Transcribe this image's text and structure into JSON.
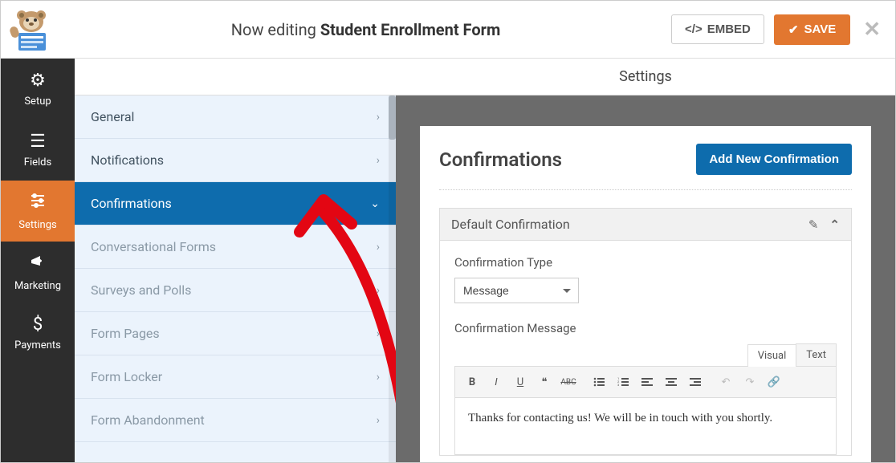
{
  "header": {
    "editing_prefix": "Now editing ",
    "form_name": "Student Enrollment Form",
    "embed_label": "EMBED",
    "save_label": "SAVE"
  },
  "sidebar": {
    "items": [
      {
        "label": "Setup"
      },
      {
        "label": "Fields"
      },
      {
        "label": "Settings"
      },
      {
        "label": "Marketing"
      },
      {
        "label": "Payments"
      }
    ]
  },
  "settings_menu": {
    "items": [
      {
        "label": "General"
      },
      {
        "label": "Notifications"
      },
      {
        "label": "Confirmations"
      },
      {
        "label": "Conversational Forms"
      },
      {
        "label": "Surveys and Polls"
      },
      {
        "label": "Form Pages"
      },
      {
        "label": "Form Locker"
      },
      {
        "label": "Form Abandonment"
      }
    ]
  },
  "right": {
    "header": "Settings",
    "panel_title": "Confirmations",
    "add_new_label": "Add New Confirmation",
    "conf_name": "Default Confirmation",
    "type_label": "Confirmation Type",
    "type_value": "Message",
    "message_label": "Confirmation Message",
    "tabs": {
      "visual": "Visual",
      "text": "Text"
    },
    "message_body": "Thanks for contacting us! We will be in touch with you shortly."
  }
}
